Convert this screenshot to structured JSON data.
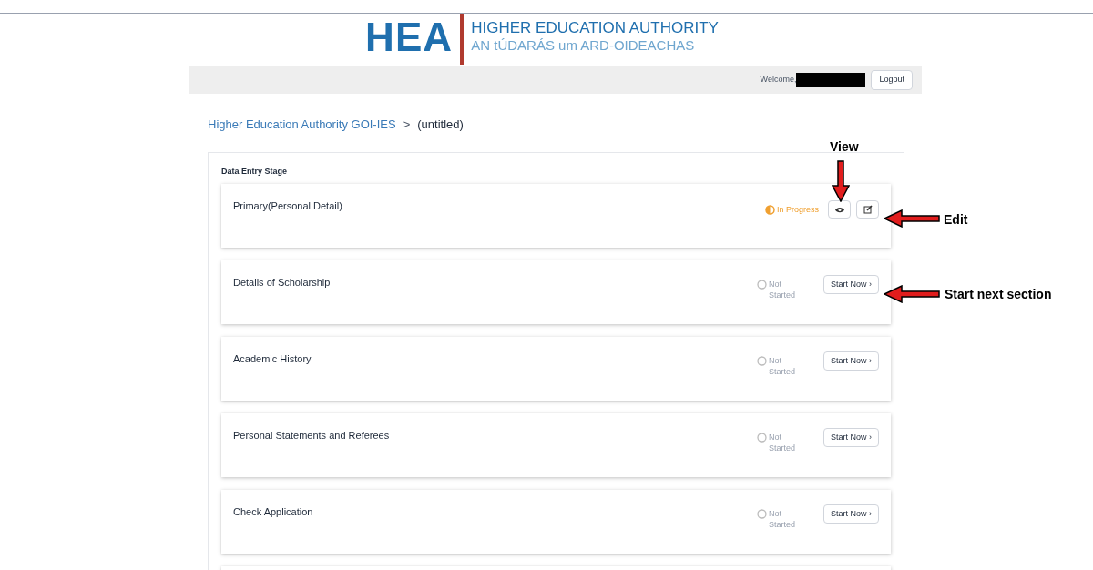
{
  "logo": {
    "mark": "HEA",
    "name": "HIGHER EDUCATION AUTHORITY",
    "subtitle": "AN tÚDARÁS um ARD-OIDEACHAS"
  },
  "top_bar": {
    "welcome": "Welcome,",
    "logout": "Logout"
  },
  "breadcrumb": {
    "link": "Higher Education Authority GOI-IES",
    "separator": ">",
    "current": "(untitled)"
  },
  "stage": {
    "title": "Data Entry Stage",
    "sections": [
      {
        "title": "Primary(Personal Detail)",
        "kind": "in_progress",
        "status": "In Progress"
      },
      {
        "title": "Details of Scholarship",
        "kind": "not_started",
        "status": "Not Started",
        "action": "Start Now ›"
      },
      {
        "title": "Academic History",
        "kind": "not_started",
        "status": "Not Started",
        "action": "Start Now ›"
      },
      {
        "title": "Personal Statements and Referees",
        "kind": "not_started",
        "status": "Not Started",
        "action": "Start Now ›"
      },
      {
        "title": "Check Application",
        "kind": "not_started",
        "status": "Not Started",
        "action": "Start Now ›"
      }
    ]
  },
  "annotations": [
    {
      "label": "View",
      "kind": "down"
    },
    {
      "label": "Edit",
      "kind": "left"
    },
    {
      "label": "Start next section",
      "kind": "left"
    }
  ]
}
